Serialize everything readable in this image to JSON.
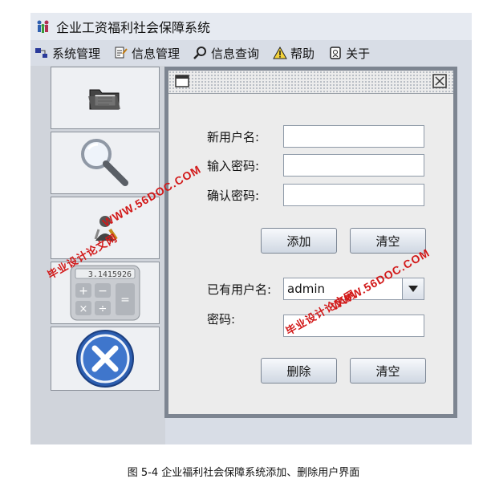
{
  "window": {
    "title": "企业工资福利社会保障系统"
  },
  "menu": [
    {
      "label": "系统管理",
      "icon": "system-icon"
    },
    {
      "label": "信息管理",
      "icon": "info-manage-icon"
    },
    {
      "label": "信息查询",
      "icon": "search-icon"
    },
    {
      "label": "帮助",
      "icon": "warning-icon"
    },
    {
      "label": "关于",
      "icon": "about-icon"
    }
  ],
  "sidebar": {
    "buttons": [
      "folder-icon",
      "magnifier-icon",
      "user-tools-icon",
      "calculator-icon",
      "exit-icon"
    ],
    "calculator_display": "3.1415926"
  },
  "form": {
    "new_user_label": "新用户名:",
    "password_label": "输入密码:",
    "confirm_label": "确认密码:",
    "add_button": "添加",
    "clear_button": "清空",
    "existing_user_label": "已有用户名:",
    "existing_user_value": "admin",
    "existing_password_label": "密码:",
    "delete_button": "删除",
    "clear_button_2": "清空"
  },
  "watermark": {
    "url": "WWW.56DOC.COM",
    "site": "毕业设计论文网"
  },
  "caption": "图 5-4 企业福利社会保障系统添加、删除用户界面"
}
